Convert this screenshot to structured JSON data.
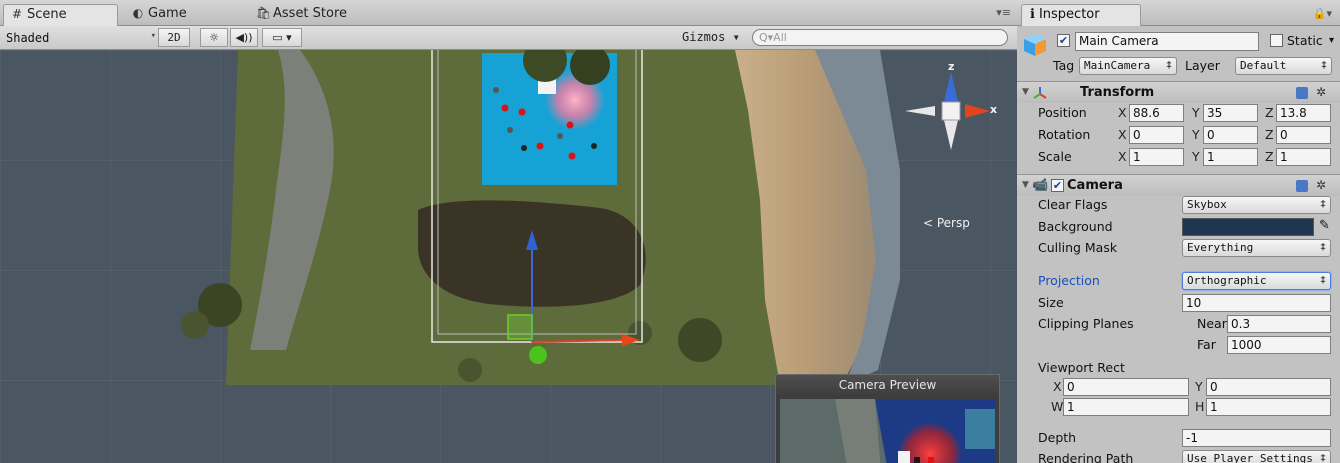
{
  "scene_panel": {
    "tabs": [
      {
        "label": "Scene",
        "icon": "#"
      },
      {
        "label": "Game",
        "icon": "◐"
      },
      {
        "label": "Asset Store",
        "icon": "🛍"
      }
    ],
    "tab_menu_glyph": "▾≡",
    "toolbar": {
      "shading_mode": "Shaded",
      "mode_2d": "2D",
      "light_glyph": "☼",
      "audio_glyph": "◀))",
      "fx_glyph": "▭ ▾",
      "gizmos": "Gizmos ▾",
      "search_placeholder": "Q▾All"
    },
    "orientation_gizmo": {
      "y_label": "z",
      "x_label": "x",
      "projection": "< Persp"
    },
    "camera_preview": {
      "title": "Camera Preview"
    }
  },
  "inspector": {
    "tab_label": "Inspector",
    "tab_icon": "ℹ",
    "lock_glyph": "🔒▾",
    "object": {
      "name": "Main Camera",
      "active": true,
      "static_label": "Static",
      "static_checked": false,
      "tag_label": "Tag",
      "tag_value": "MainCamera",
      "layer_label": "Layer",
      "layer_value": "Default"
    },
    "transform": {
      "title": "Transform",
      "position_label": "Position",
      "rotation_label": "Rotation",
      "scale_label": "Scale",
      "position": {
        "x": "88.6",
        "y": "35",
        "z": "13.8"
      },
      "rotation": {
        "x": "0",
        "y": "0",
        "z": "0"
      },
      "scale": {
        "x": "1",
        "y": "1",
        "z": "1"
      }
    },
    "camera": {
      "title": "Camera",
      "enabled": true,
      "clear_flags_label": "Clear Flags",
      "clear_flags": "Skybox",
      "background_label": "Background",
      "background_color": "#1f3650",
      "culling_mask_label": "Culling Mask",
      "culling_mask": "Everything",
      "projection_label": "Projection",
      "projection": "Orthographic",
      "size_label": "Size",
      "size": "10",
      "clipping_label": "Clipping Planes",
      "near_label": "Near",
      "near": "0.3",
      "far_label": "Far",
      "far": "1000",
      "viewport_label": "Viewport Rect",
      "viewport": {
        "x": "0",
        "y": "0",
        "w": "1",
        "h": "1"
      },
      "depth_label": "Depth",
      "depth": "-1",
      "rendering_path_label": "Rendering Path",
      "rendering_path": "Use Player Settings"
    }
  }
}
